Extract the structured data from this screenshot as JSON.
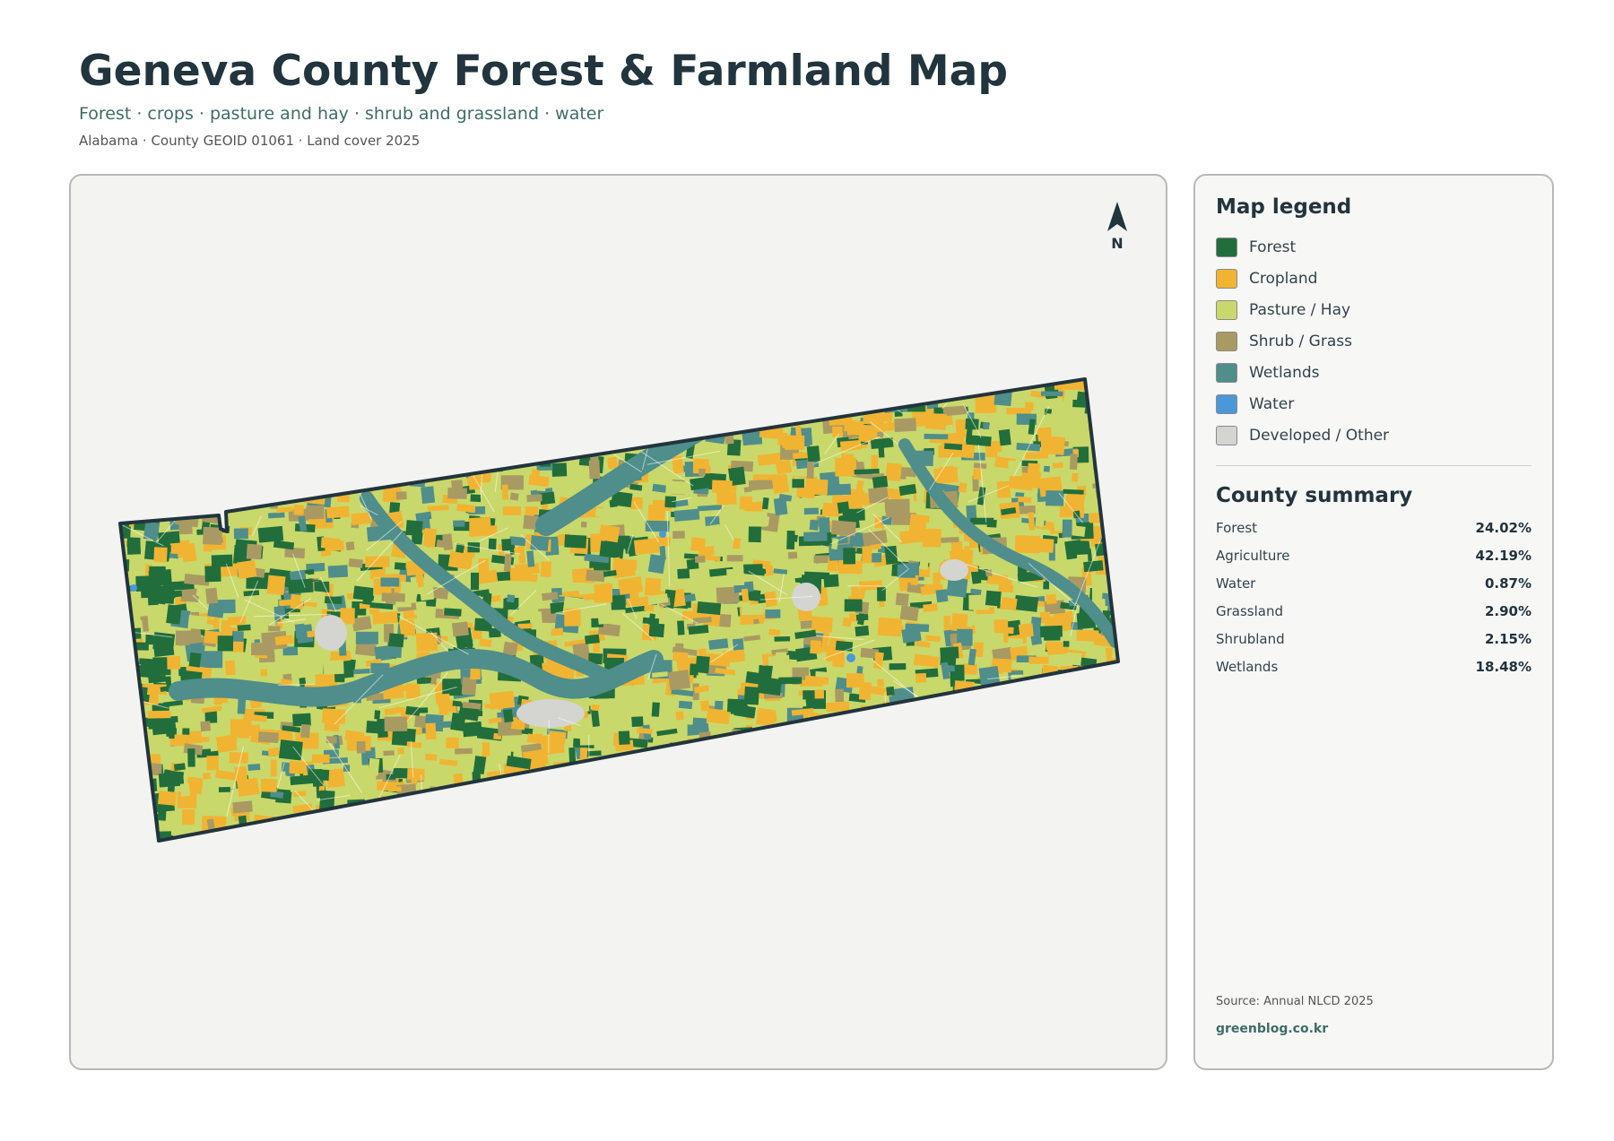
{
  "header": {
    "title": "Geneva County Forest & Farmland Map",
    "subtitle": "Forest · crops · pasture and hay · shrub and grassland · water",
    "meta": "Alabama · County GEOID 01061 · Land cover 2025"
  },
  "map": {
    "north_label": "N",
    "colors": {
      "forest": "#216e3c",
      "cropland": "#f0b432",
      "pasture": "#c9d86a",
      "shrub": "#a99a63",
      "wetlands": "#4f8e8b",
      "water": "#4a98d8",
      "developed": "#d4d4d0",
      "boundary": "#22343d"
    }
  },
  "legend": {
    "title": "Map legend",
    "items": [
      {
        "label": "Forest",
        "color": "#216e3c"
      },
      {
        "label": "Cropland",
        "color": "#f0b432"
      },
      {
        "label": "Pasture / Hay",
        "color": "#c9d86a"
      },
      {
        "label": "Shrub / Grass",
        "color": "#a99a63"
      },
      {
        "label": "Wetlands",
        "color": "#4f8e8b"
      },
      {
        "label": "Water",
        "color": "#4a98d8"
      },
      {
        "label": "Developed / Other",
        "color": "#d4d4d0"
      }
    ]
  },
  "summary": {
    "title": "County summary",
    "rows": [
      {
        "label": "Forest",
        "value": "24.02%"
      },
      {
        "label": "Agriculture",
        "value": "42.19%"
      },
      {
        "label": "Water",
        "value": "0.87%"
      },
      {
        "label": "Grassland",
        "value": "2.90%"
      },
      {
        "label": "Shrubland",
        "value": "2.15%"
      },
      {
        "label": "Wetlands",
        "value": "18.48%"
      }
    ]
  },
  "footer": {
    "source": "Source: Annual NLCD 2025",
    "site": "greenblog.co.kr"
  }
}
